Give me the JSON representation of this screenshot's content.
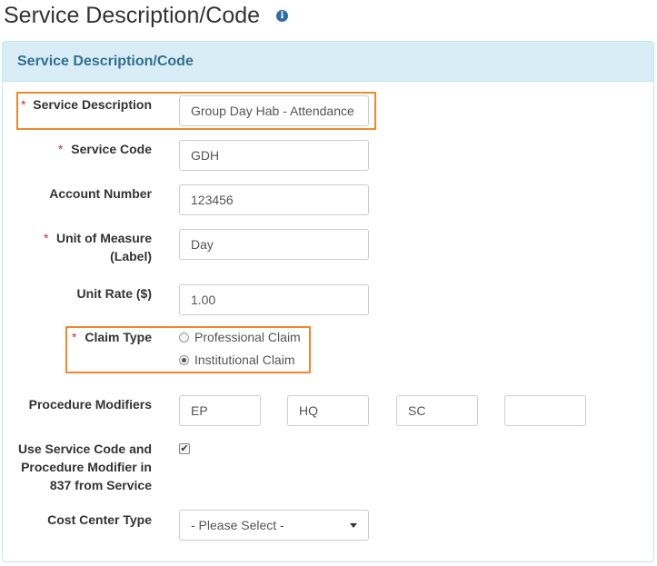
{
  "page": {
    "title": "Service Description/Code"
  },
  "panel": {
    "title": "Service Description/Code"
  },
  "fields": {
    "service_description": {
      "label": "Service Description",
      "value": "Group Day Hab - Attendance",
      "required": true
    },
    "service_code": {
      "label": "Service Code",
      "value": "GDH",
      "required": true
    },
    "account_number": {
      "label": "Account Number",
      "value": "123456",
      "required": false
    },
    "unit_of_measure": {
      "label_line1": "Unit of Measure",
      "label_line2": "(Label)",
      "value": "Day",
      "required": true
    },
    "unit_rate": {
      "label": "Unit Rate ($)",
      "value": "1.00",
      "required": false
    },
    "claim_type": {
      "label": "Claim Type",
      "required": true,
      "options": [
        "Professional Claim",
        "Institutional Claim"
      ],
      "selected": "Institutional Claim"
    },
    "procedure_modifiers": {
      "label": "Procedure Modifiers",
      "values": [
        "EP",
        "HQ",
        "SC",
        ""
      ]
    },
    "use_service_code": {
      "label_lines": [
        "Use Service Code and",
        "Procedure Modifier in",
        "837 from Service"
      ],
      "checked": true
    },
    "cost_center_type": {
      "label": "Cost Center Type",
      "selected": "- Please Select -"
    }
  },
  "required_marker": "*",
  "colors": {
    "panel_heading_bg": "#d9edf7",
    "panel_title": "#31708f",
    "highlight": "#f0882a",
    "required": "#c9302c",
    "info_icon": "#2e6da4"
  }
}
